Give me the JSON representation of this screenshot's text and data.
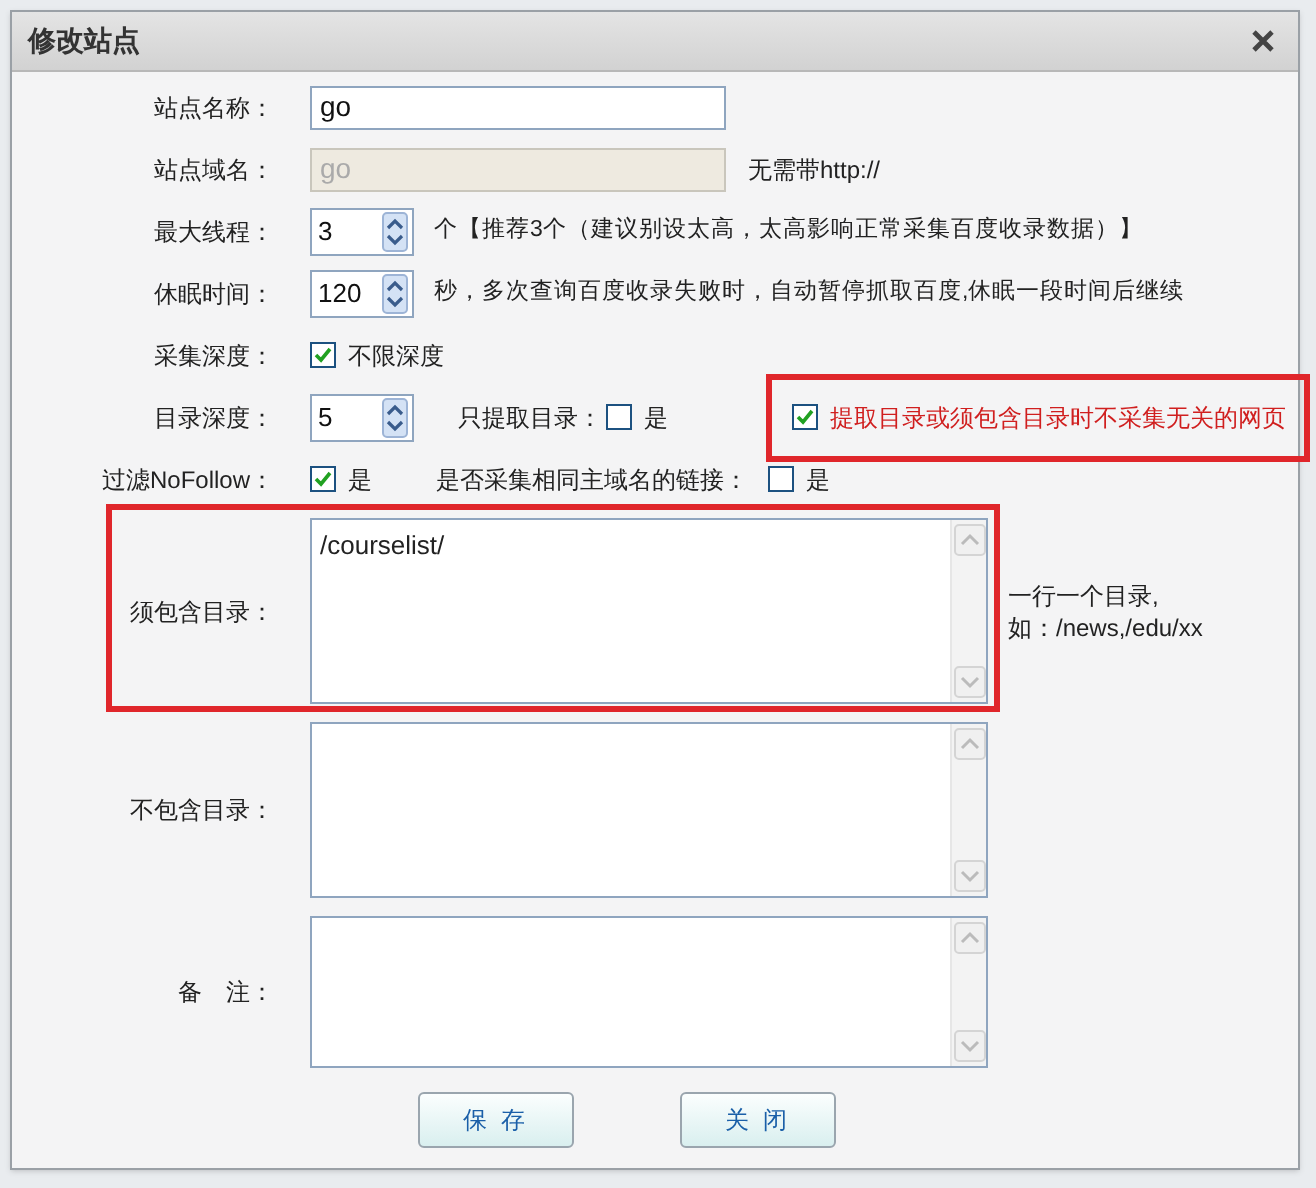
{
  "dialog": {
    "title": "修改站点"
  },
  "fields": [
    {
      "kind": "text",
      "label": "站点名称：",
      "value": "go",
      "disabled": false
    },
    {
      "kind": "text",
      "label": "站点域名：",
      "value": "go",
      "disabled": true,
      "hint": "无需带http://"
    },
    {
      "kind": "spinner",
      "label": "最大线程：",
      "value": "3",
      "hint": "个【推荐3个（建议别设太高，太高影响正常采集百度收录数据）】"
    },
    {
      "kind": "spinner",
      "label": "休眠时间：",
      "value": "120",
      "hint": "秒，多次查询百度收录失败时，自动暂停抓取百度,休眠一段时间后继续"
    },
    {
      "kind": "checks",
      "label": "采集深度：",
      "options": [
        {
          "label": "不限深度",
          "checked": true,
          "highlighted": false
        }
      ]
    },
    {
      "kind": "spinner",
      "label": "目录深度：",
      "value": "5",
      "options": [
        {
          "prefix": "只提取目录：",
          "label": "是",
          "checked": false,
          "highlighted": false
        },
        {
          "label": "提取目录或须包含目录时不采集无关的网页",
          "checked": true,
          "highlighted": true
        }
      ]
    },
    {
      "kind": "checks",
      "label": "过滤NoFollow：",
      "options": [
        {
          "label": "是",
          "checked": true,
          "highlighted": false
        },
        {
          "prefix": "是否采集相同主域名的链接：",
          "label": "是",
          "checked": false,
          "highlighted": false
        }
      ]
    },
    {
      "kind": "textarea",
      "label": "须包含目录：",
      "value": "/courselist/",
      "hint_lines": [
        "一行一个目录,",
        "如：/news,/edu/xx"
      ],
      "highlighted": true
    },
    {
      "kind": "textarea",
      "label": "不包含目录：",
      "highlighted": false
    },
    {
      "kind": "textarea",
      "label": "备　注：",
      "highlighted": false
    }
  ],
  "buttons": [
    {
      "label": "保 存"
    },
    {
      "label": "关 闭"
    }
  ]
}
